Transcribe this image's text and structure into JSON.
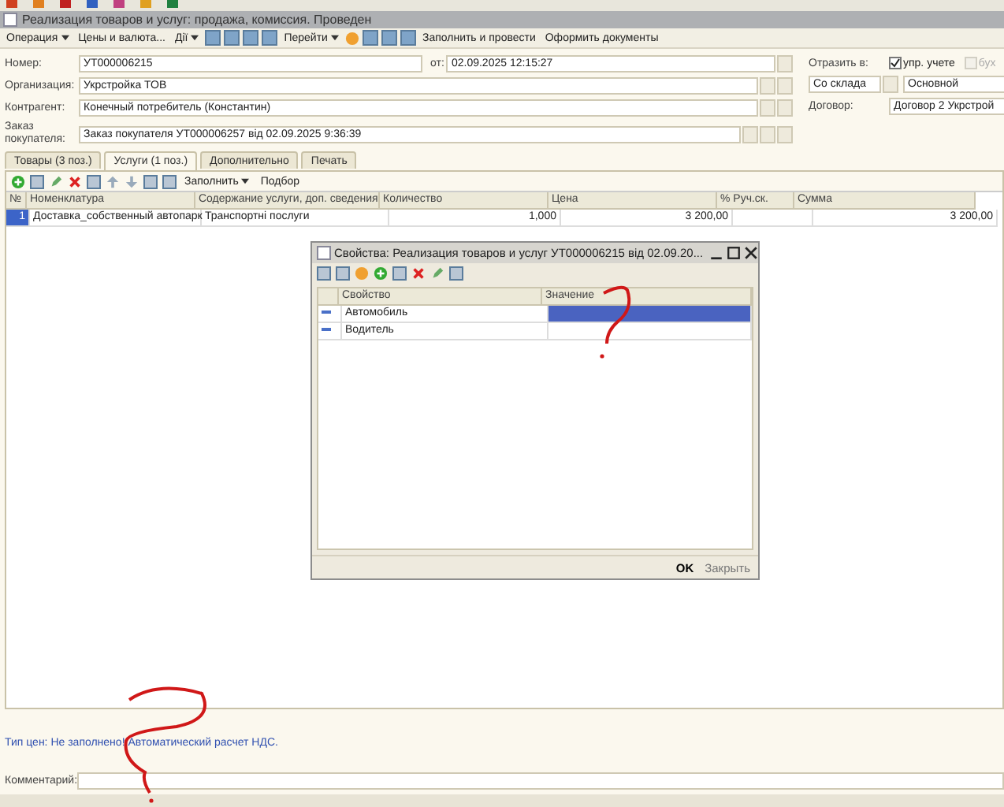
{
  "window": {
    "title": "Реализация товаров и услуг: продажа, комиссия. Проведен"
  },
  "toolbar": [
    {
      "kind": "menu",
      "label": "Операция"
    },
    {
      "kind": "button",
      "label": "Цены и валюта..."
    },
    {
      "kind": "menu",
      "label": "Дії"
    },
    {
      "kind": "menu",
      "label": "Перейти"
    },
    {
      "kind": "button",
      "label": "Заполнить и провести"
    },
    {
      "kind": "button",
      "label": "Оформить документы"
    }
  ],
  "fields": {
    "number_label": "Номер:",
    "number": "УТ000006215",
    "date_label": "от:",
    "date": "02.09.2025 12:15:27",
    "organization_label": "Организация:",
    "organization": "Укрстройка ТОВ",
    "counterparty_label": "Контрагент:",
    "counterparty": "Конечный потребитель (Константин)",
    "order_label": "Заказ покупателя:",
    "order": "Заказ покупателя УТ000006257 від 02.09.2025 9:36:39"
  },
  "reflect": {
    "label": "Отразить в:",
    "options": [
      {
        "label": "упр. учете",
        "checked": true,
        "disabled": false
      },
      {
        "label": "бух",
        "checked": false,
        "disabled": true
      }
    ]
  },
  "warehouse": {
    "mode": "Со склада",
    "value": "Основной"
  },
  "contract": {
    "label": "Договор:",
    "value": "Договор 2 Укрстрой"
  },
  "tabs": [
    {
      "label": "Товары (3 поз.)",
      "selected": false
    },
    {
      "label": "Услуги (1 поз.)",
      "selected": true
    },
    {
      "label": "Дополнительно",
      "selected": false
    },
    {
      "label": "Печать",
      "selected": false
    }
  ],
  "table_toolbar": {
    "fill": "Заполнить",
    "pick": "Подбор"
  },
  "table": {
    "columns": [
      "№",
      "Номенклатура",
      "Содержание услуги, доп. сведения",
      "Количество",
      "Цена",
      "% Руч.ск.",
      "Сумма"
    ],
    "rows": [
      {
        "cells": [
          "1",
          "Доставка_собственный автопарк",
          "Транспортні послуги",
          "1,000",
          "3 200,00",
          "",
          "3 200,00"
        ],
        "selected": true
      }
    ]
  },
  "info": "Тип цен: Не заполнено! Автоматический расчет НДС.",
  "comment": {
    "label": "Комментарий:"
  },
  "dialog": {
    "title": "Свойства: Реализация товаров и услуг УТ000006215 від 02.09.20...",
    "columns": [
      "Свойство",
      "Значение"
    ],
    "rows": [
      {
        "name": "Автомобиль",
        "selected": true
      },
      {
        "name": "Водитель",
        "selected": false
      }
    ],
    "ok": "OK",
    "close": "Закрыть"
  }
}
